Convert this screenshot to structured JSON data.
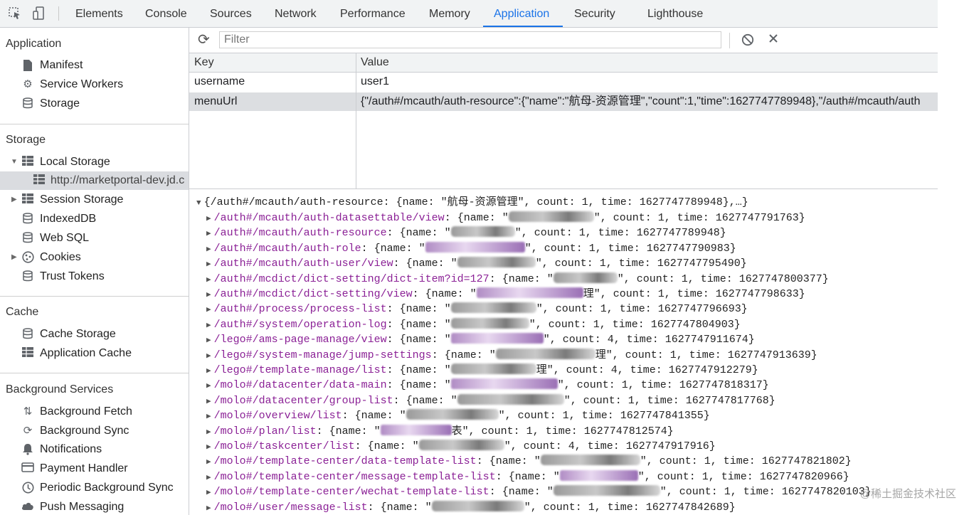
{
  "tabs": [
    "Elements",
    "Console",
    "Sources",
    "Network",
    "Performance",
    "Memory",
    "Application",
    "Security",
    "Lighthouse"
  ],
  "active_tab": "Application",
  "sidebar": {
    "application": {
      "title": "Application",
      "items": [
        "Manifest",
        "Service Workers",
        "Storage"
      ]
    },
    "storage": {
      "title": "Storage",
      "local_storage": "Local Storage",
      "local_origin": "http://marketportal-dev.jd.c",
      "items": [
        "Session Storage",
        "IndexedDB",
        "Web SQL",
        "Cookies",
        "Trust Tokens"
      ]
    },
    "cache": {
      "title": "Cache",
      "items": [
        "Cache Storage",
        "Application Cache"
      ]
    },
    "background": {
      "title": "Background Services",
      "items": [
        "Background Fetch",
        "Background Sync",
        "Notifications",
        "Payment Handler",
        "Periodic Background Sync",
        "Push Messaging"
      ]
    }
  },
  "toolbar": {
    "filter_placeholder": "Filter"
  },
  "table": {
    "headers": {
      "key": "Key",
      "value": "Value"
    },
    "rows": [
      {
        "key": "username",
        "value": "user1"
      },
      {
        "key": "menuUrl",
        "value": "{\"/auth#/mcauth/auth-resource\":{\"name\":\"航母-资源管理\",\"count\":1,\"time\":1627747789948},\"/auth#/mcauth/auth"
      }
    ]
  },
  "preview": {
    "root": "{/auth#/mcauth/auth-resource: {name: \"航母-资源管理\", count: 1, time: 1627747789948},…}",
    "lines": [
      {
        "path": "/auth#/mcauth/auth-datasettable/view",
        "tail": "\", count: 1, time: 1627747791763}"
      },
      {
        "path": "/auth#/mcauth/auth-resource",
        "tail": "\", count: 1, time: 1627747789948}"
      },
      {
        "path": "/auth#/mcauth/auth-role",
        "tail": "\", count: 1, time: 1627747790983}"
      },
      {
        "path": "/auth#/mcauth/auth-user/view",
        "tail": "\", count: 1, time: 1627747795490}"
      },
      {
        "path": "/auth#/mcdict/dict-setting/dict-item?id=127",
        "tail": "\", count: 1, time: 1627747800377}"
      },
      {
        "path": "/auth#/mcdict/dict-setting/view",
        "tail": "理\", count: 1, time: 1627747798633}"
      },
      {
        "path": "/auth#/process/process-list",
        "tail": "\", count: 1, time: 1627747796693}"
      },
      {
        "path": "/auth#/system/operation-log",
        "tail": "\", count: 1, time: 1627747804903}"
      },
      {
        "path": "/lego#/ams-page-manage/view",
        "tail": "\", count: 4, time: 1627747911674}"
      },
      {
        "path": "/lego#/system-manage/jump-settings",
        "tail": "理\", count: 1, time: 1627747913639}"
      },
      {
        "path": "/lego#/template-manage/list",
        "tail": "理\", count: 4, time: 1627747912279}"
      },
      {
        "path": "/molo#/datacenter/data-main",
        "tail": "\", count: 1, time: 1627747818317}"
      },
      {
        "path": "/molo#/datacenter/group-list",
        "tail": "\", count: 1, time: 1627747817768}"
      },
      {
        "path": "/molo#/overview/list",
        "tail": "\", count: 1, time: 1627747841355}"
      },
      {
        "path": "/molo#/plan/list",
        "tail": "表\", count: 1, time: 1627747812574}"
      },
      {
        "path": "/molo#/taskcenter/list",
        "tail": "\", count: 4, time: 1627747917916}"
      },
      {
        "path": "/molo#/template-center/data-template-list",
        "tail": "\", count: 1, time: 1627747821802}"
      },
      {
        "path": "/molo#/template-center/message-template-list",
        "tail": "\", count: 1, time: 1627747820966}"
      },
      {
        "path": "/molo#/template-center/wechat-template-list",
        "tail": "\", count: 1, time: 1627747820103}"
      },
      {
        "path": "/molo#/user/message-list",
        "tail": "\", count: 1, time: 1627747842689}"
      }
    ]
  },
  "watermark": "@稀土掘金技术社区",
  "colors": {
    "accent": "#1a73e8",
    "key": "#8b2196",
    "selected_row": "#dcdee1"
  }
}
